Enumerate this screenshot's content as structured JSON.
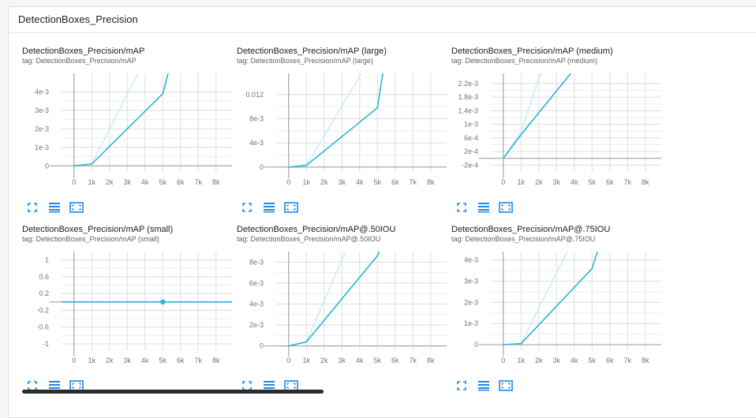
{
  "panel": {
    "title": "DetectionBoxes_Precision"
  },
  "colors": {
    "line": "#26b5d9",
    "smoothed_ghost": "#c6ebf5",
    "grid": "#dddddd",
    "axis": "#999999",
    "tick_text": "#757575",
    "icon": "#1e88e5"
  },
  "toolbar_icons": [
    "fullscreen-icon",
    "toggle-log-scale-icon",
    "fit-domain-icon"
  ],
  "charts": [
    {
      "title": "DetectionBoxes_Precision/mAP",
      "tag": "tag: DetectionBoxes_Precision/mAP",
      "chart_data": {
        "type": "line",
        "x_ticks": [
          "0",
          "1k",
          "2k",
          "3k",
          "4k",
          "5k",
          "6k",
          "7k",
          "8k"
        ],
        "y_ticks": [
          "0",
          "1e-3",
          "2e-3",
          "3e-3",
          "4e-3"
        ],
        "xlim": [
          -700,
          8900
        ],
        "ylim": [
          -0.00033,
          0.005
        ],
        "series": [
          {
            "role": "faded",
            "x": [
              0,
              1000,
              3600
            ],
            "y": [
              0,
              0.0001,
              0.005
            ]
          },
          {
            "role": "main",
            "x": [
              0,
              1000,
              5000,
              5300
            ],
            "y": [
              0,
              0.0001,
              0.0039,
              0.005
            ]
          }
        ]
      }
    },
    {
      "title": "DetectionBoxes_Precision/mAP (large)",
      "tag": "tag: DetectionBoxes_Precision/mAP (large)",
      "chart_data": {
        "type": "line",
        "x_ticks": [
          "0",
          "1k",
          "2k",
          "3k",
          "4k",
          "5k",
          "6k",
          "7k",
          "8k"
        ],
        "y_ticks": [
          "0",
          "4e-3",
          "8e-3",
          "0.012"
        ],
        "xlim": [
          -700,
          8900
        ],
        "ylim": [
          -0.0008,
          0.0155
        ],
        "series": [
          {
            "role": "faded",
            "x": [
              0,
              1000,
              4100
            ],
            "y": [
              0,
              0.0003,
              0.0155
            ]
          },
          {
            "role": "main",
            "x": [
              0,
              1000,
              5000,
              5300
            ],
            "y": [
              0,
              0.0003,
              0.0098,
              0.0155
            ]
          }
        ]
      }
    },
    {
      "title": "DetectionBoxes_Precision/mAP (medium)",
      "tag": "tag: DetectionBoxes_Precision/mAP (medium)",
      "chart_data": {
        "type": "line",
        "x_ticks": [
          "0",
          "1k",
          "2k",
          "3k",
          "4k",
          "5k",
          "6k",
          "7k",
          "8k"
        ],
        "y_ticks": [
          "-2e-4",
          "2e-4",
          "6e-4",
          "1e-3",
          "1.4e-3",
          "1.8e-3",
          "2.2e-3"
        ],
        "xlim": [
          -700,
          8900
        ],
        "ylim": [
          -0.0004,
          0.0025
        ],
        "series": [
          {
            "role": "faded",
            "x": [
              0,
              1000,
              2100
            ],
            "y": [
              0,
              0.0008,
              0.0025
            ]
          },
          {
            "role": "main",
            "x": [
              0,
              1000,
              3800
            ],
            "y": [
              0,
              0.0007,
              0.0025
            ]
          }
        ]
      }
    },
    {
      "title": "DetectionBoxes_Precision/mAP (small)",
      "tag": "tag: DetectionBoxes_Precision/mAP (small)",
      "chart_data": {
        "type": "line",
        "x_ticks": [
          "0",
          "1k",
          "2k",
          "3k",
          "4k",
          "5k",
          "6k",
          "7k",
          "8k"
        ],
        "y_ticks": [
          "-1",
          "-0.6",
          "-0.2",
          "0.2",
          "0.6",
          "1"
        ],
        "xlim": [
          -700,
          8900
        ],
        "ylim": [
          -1.15,
          1.2
        ],
        "series": [
          {
            "role": "main",
            "x": [
              -700,
              8900
            ],
            "y": [
              0,
              0
            ],
            "marker_x": 5000
          }
        ]
      }
    },
    {
      "title": "DetectionBoxes_Precision/mAP@.50IOU",
      "tag": "tag: DetectionBoxes_Precision/mAP@.50IOU",
      "chart_data": {
        "type": "line",
        "x_ticks": [
          "0",
          "1k",
          "2k",
          "3k",
          "4k",
          "5k",
          "6k",
          "7k",
          "8k"
        ],
        "y_ticks": [
          "0",
          "2e-3",
          "4e-3",
          "6e-3",
          "8e-3"
        ],
        "xlim": [
          -700,
          8900
        ],
        "ylim": [
          -0.0004,
          0.009
        ],
        "series": [
          {
            "role": "faded",
            "x": [
              0,
              1000,
              3200
            ],
            "y": [
              0,
              0.0004,
              0.009
            ]
          },
          {
            "role": "main",
            "x": [
              0,
              1000,
              5000,
              5100
            ],
            "y": [
              0,
              0.0004,
              0.0086,
              0.009
            ]
          }
        ]
      }
    },
    {
      "title": "DetectionBoxes_Precision/mAP@.75IOU",
      "tag": "tag: DetectionBoxes_Precision/mAP@.75IOU",
      "chart_data": {
        "type": "line",
        "x_ticks": [
          "0",
          "1k",
          "2k",
          "3k",
          "4k",
          "5k",
          "6k",
          "7k",
          "8k"
        ],
        "y_ticks": [
          "0",
          "1e-3",
          "2e-3",
          "3e-3",
          "4e-3"
        ],
        "xlim": [
          -700,
          8900
        ],
        "ylim": [
          -0.00026,
          0.0044
        ],
        "series": [
          {
            "role": "faded",
            "x": [
              0,
              1000,
              3600
            ],
            "y": [
              0,
              5e-05,
              0.0044
            ]
          },
          {
            "role": "main",
            "x": [
              0,
              1000,
              5000,
              5300
            ],
            "y": [
              0,
              5e-05,
              0.0036,
              0.0044
            ]
          }
        ]
      }
    }
  ]
}
